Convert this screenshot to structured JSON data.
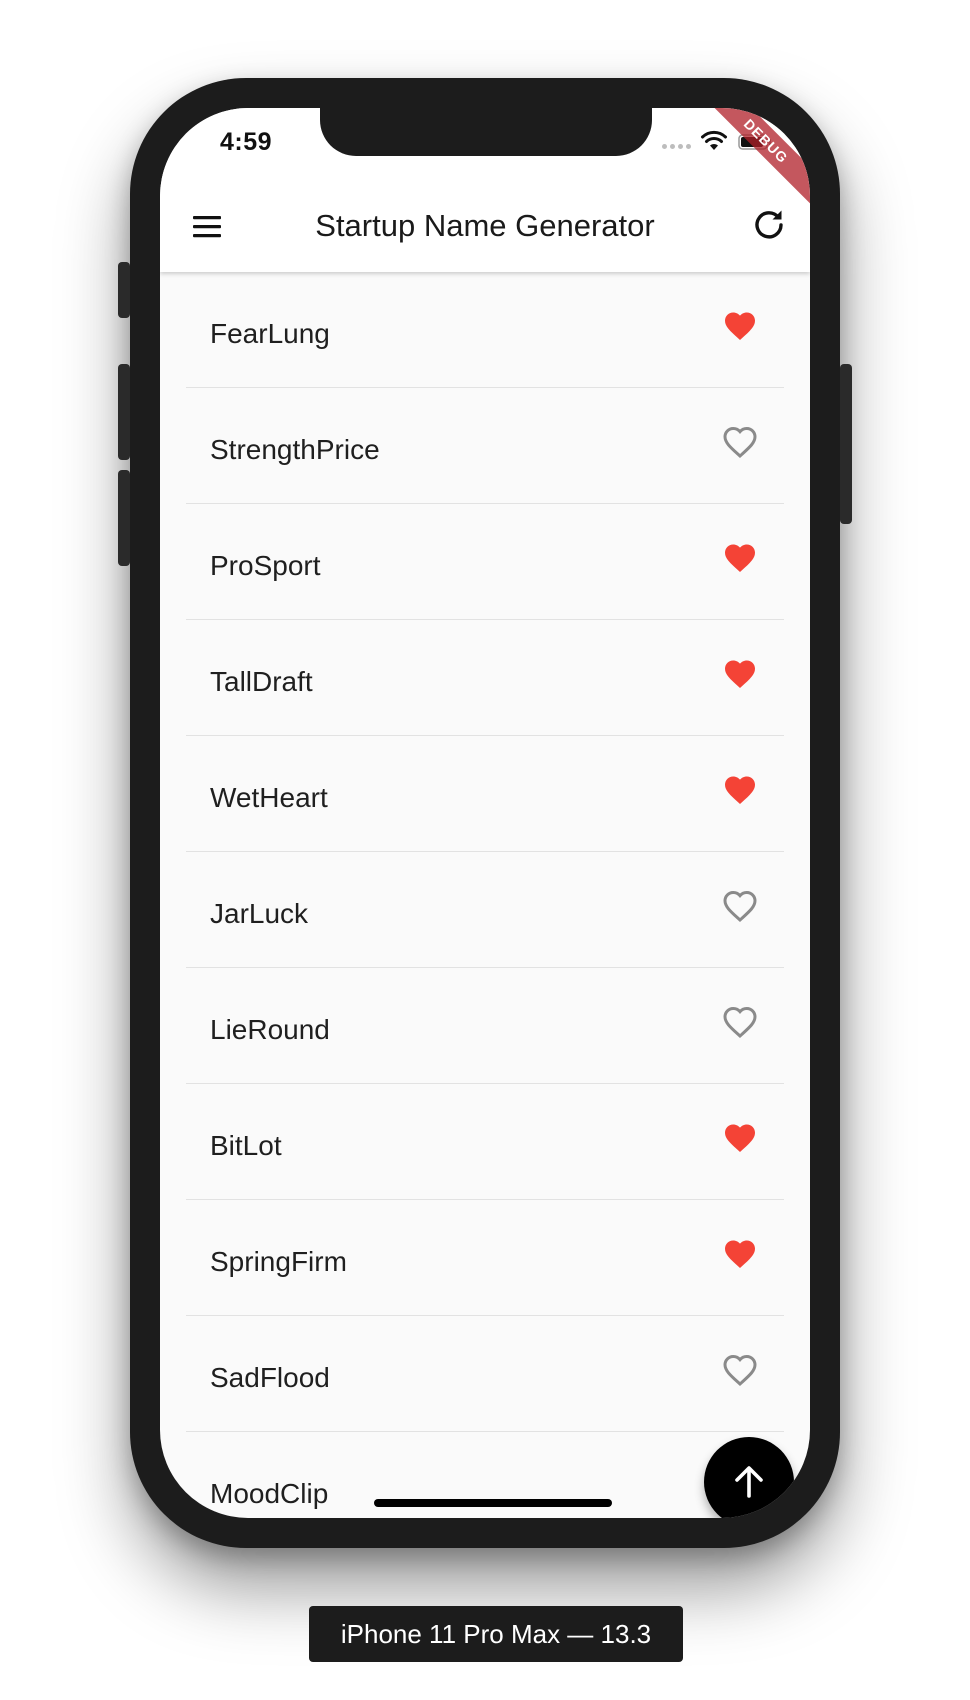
{
  "status_bar": {
    "time": "4:59",
    "debug_banner": "DEBUG"
  },
  "app_bar": {
    "title": "Startup Name Generator",
    "menu_icon": "menu-icon",
    "refresh_icon": "refresh-icon"
  },
  "list": {
    "items": [
      {
        "name": "FearLung",
        "favorited": true
      },
      {
        "name": "StrengthPrice",
        "favorited": false
      },
      {
        "name": "ProSport",
        "favorited": true
      },
      {
        "name": "TallDraft",
        "favorited": true
      },
      {
        "name": "WetHeart",
        "favorited": true
      },
      {
        "name": "JarLuck",
        "favorited": false
      },
      {
        "name": "LieRound",
        "favorited": false
      },
      {
        "name": "BitLot",
        "favorited": true
      },
      {
        "name": "SpringFirm",
        "favorited": true
      },
      {
        "name": "SadFlood",
        "favorited": false
      },
      {
        "name": "MoodClip",
        "favorited": false
      }
    ]
  },
  "fab": {
    "icon": "arrow-up-icon"
  },
  "colors": {
    "favorite": "#f44336",
    "unfavorite": "#8a8a8a",
    "fab": "#000000",
    "background": "#fafafa"
  },
  "device_caption": "iPhone 11 Pro Max — 13.3"
}
